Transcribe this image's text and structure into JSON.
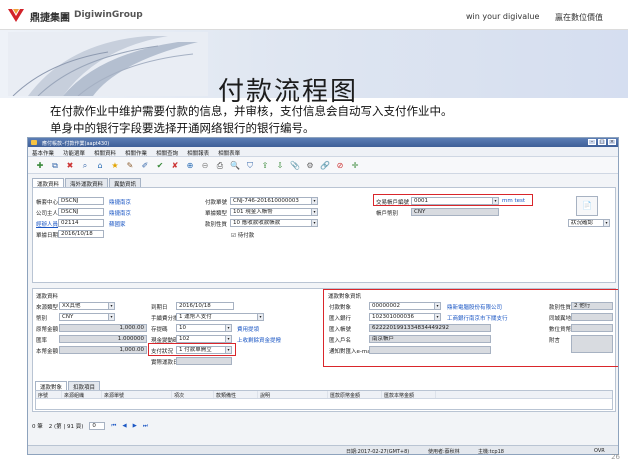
{
  "slide": {
    "brand_cn": "鼎捷集團",
    "brand_en": "DigiwinGroup",
    "slogan_en": "win your digivalue",
    "slogan_cn": "贏在數位價值",
    "title": "付款流程图",
    "desc_line1": "在付款作业中维护需要付款的信息，并审核，支付信息会自动写入支付作业中。",
    "desc_line2": "单身中的银行字段要选择开通网络银行的银行编号。",
    "page_number": "26"
  },
  "app": {
    "title": "應付帳款–付款作業(aapt430)",
    "menus": [
      "基本作業",
      "功能選單",
      "相關資料",
      "相關作業",
      "相關查詢",
      "相關報表",
      "相關表單"
    ],
    "toolbar_icons": [
      "new-icon",
      "copy-icon",
      "delete-icon",
      "find-icon",
      "home-icon",
      "favorite-icon",
      "note-icon",
      "edit-icon",
      "approve-icon",
      "disapprove-icon",
      "confirm-icon",
      "unconfirm-icon",
      "print-icon",
      "search-icon",
      "filter-icon",
      "export-icon",
      "import-icon",
      "attach-icon",
      "settings-icon",
      "link-icon",
      "close-icon",
      "more-icon"
    ],
    "toolbar_glyphs": [
      "✚",
      "⧉",
      "✖",
      "⌕",
      "⌂",
      "★",
      "✎",
      "✐",
      "✔",
      "✘",
      "⊕",
      "⊖",
      "⎙",
      "🔍",
      "⛉",
      "⇪",
      "⇩",
      "📎",
      "⚙",
      "🔗",
      "⊘",
      "✛"
    ],
    "tabs": [
      "運款資料",
      "海外運款資料",
      "異動資訊"
    ],
    "head": {
      "account_center_label": "帳套中心",
      "account_center": "DSCNJ",
      "account_center_info": "鼎捷南京",
      "company_label": "公司主人",
      "company": "DSCNJ",
      "company_info": "鼎捷南京",
      "payer_label": "經辦人員",
      "payer": "02114",
      "payer_info": "蘇國家",
      "date_label": "單據日期",
      "date": "2016/10/18",
      "doc_no_label": "付款單號",
      "doc_no": "CNJ-746-201610000003",
      "doc_type_label": "單據類型",
      "doc_type": "101 現金入帳幣",
      "status_label": "款別性質",
      "status": "10 應收款收款帳款",
      "checkbox_label": "待付款",
      "trade_acct_label": "交易帳戶編號",
      "trade_acct": "0001",
      "trade_acct_info": "mm test",
      "currency_acct_label": "帳戶幣別",
      "currency_acct": "CNY",
      "confirm_button": "確認",
      "confirm_select": "狀況確認"
    },
    "body": {
      "section_left": "運款資料",
      "source_type_label": "來源類型",
      "source_type": "XX其他",
      "currency_label": "幣別",
      "currency": "CNY",
      "orig_amount_label": "原幣金額",
      "orig_amount": "1,000.00",
      "rate_label": "匯率",
      "rate": "1.000000",
      "local_amount_label": "本幣金額",
      "local_amount": "1,000.00",
      "due_date_label": "到期日",
      "due_date": "2016/10/18",
      "pay_method_label": "手續費分擔",
      "pay_method": "1 運幣人支付",
      "settle_label": "存提碼",
      "settle": "10",
      "settle_info": "費用提領",
      "cashflow_label": "現金變動碼",
      "cashflow": "102",
      "cashflow_info": "上收剩餘資金提撥",
      "pay_status_label": "支付狀況",
      "pay_status": "1 付款單開立",
      "pay_date_label": "實際運款日",
      "pay_date": "",
      "section_right": "運款對象資訊",
      "payee_label": "付款對象",
      "payee": "00000002",
      "payee_info": "鼎新電腦股份有限公司",
      "bank_label": "匯入銀行",
      "bank": "102301000036",
      "bank_info": "工商銀行南京市下關支行",
      "account_label": "匯入帳號",
      "account": "6222201991334834449292",
      "name_label": "匯入戶名",
      "name": "南京帳戶",
      "email_label": "通知對匯入e-mail",
      "email": "",
      "fee_type_label": "款別性質",
      "fee_type": "2 他行",
      "region_label": "同城異地",
      "region": "",
      "unit_label": "數位貨幣",
      "unit": "",
      "memo_label": "附言",
      "memo": ""
    },
    "grid_tabs": [
      "運款對象",
      "扣款項目"
    ],
    "grid_headers": [
      "序號",
      "來源組織",
      "來源單號",
      "項次",
      "款類備性",
      "說明",
      "匯款原幣金額",
      "匯款本幣金額"
    ],
    "pager": {
      "page": "2",
      "info": "2 (第 | 91 頁)",
      "total": "0 筆",
      "current": "0"
    },
    "status_bar": {
      "date": "日期:2017-02-27(GMT+8)",
      "user": "使用者:蔡秋林",
      "host": "主機:tcp18",
      "flag": "OVR"
    }
  }
}
